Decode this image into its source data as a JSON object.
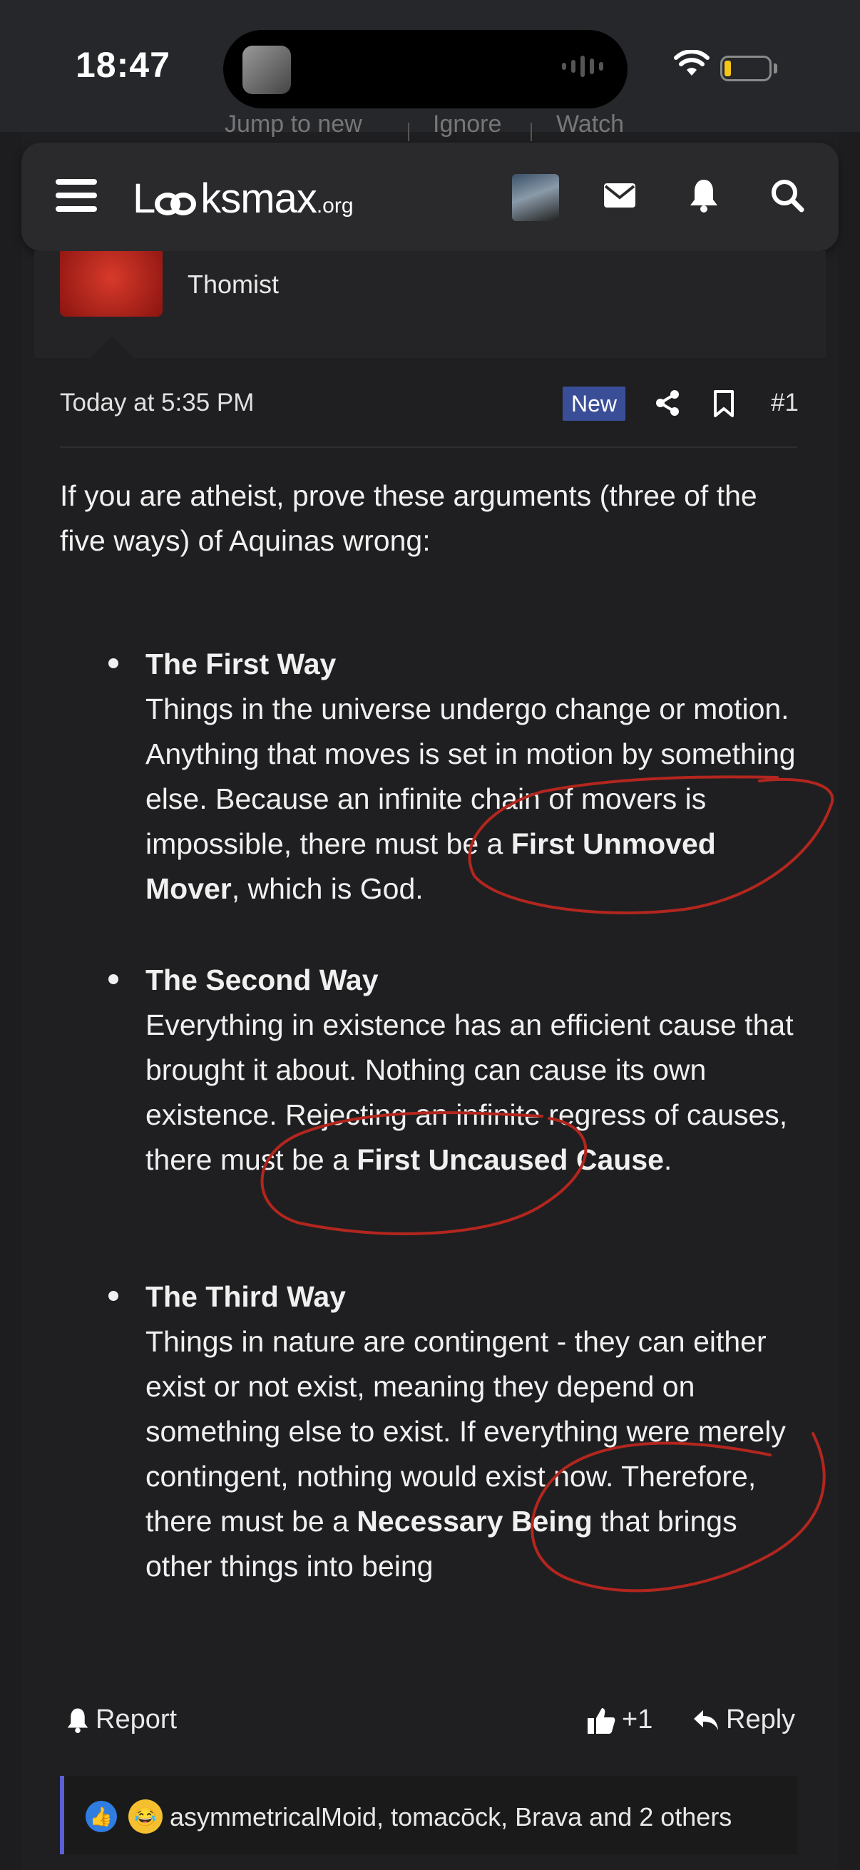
{
  "status_bar": {
    "time": "18:47"
  },
  "forum_top_links": [
    "Jump to new",
    "Ignore",
    "Watch"
  ],
  "header": {
    "logo_main": "Lks max",
    "logo_o": "oo",
    "logo_suffix": ".org"
  },
  "post": {
    "author_title": "Thomist",
    "date": "Today at 5:35 PM",
    "new_badge": "New",
    "post_number": "#1",
    "intro": "If you are atheist, prove these arguments (three of the five ways) of Aquinas wrong:",
    "ways": [
      {
        "title": "The First Way",
        "text_before": "Things in the universe undergo change or motion. Anything that moves is set in motion by something else. Because an infinite chain of movers is impossible, there must be a ",
        "bold": "First Unmoved Mover",
        "text_after": ", which is God."
      },
      {
        "title": "The Second Way",
        "text_before": "Everything in existence has an efficient cause that brought it about. Nothing can cause its own existence. Rejecting an infinite regress of causes, there must be a ",
        "bold": "First Uncaused Cause",
        "text_after": "."
      },
      {
        "title": "The Third Way",
        "text_before": "Things in nature are contingent - they can either exist or not exist, meaning they depend on something else to exist. If everything were merely contingent, nothing would exist now. Therefore, there must be a ",
        "bold": "Necessary Being",
        "text_after": " that brings other things into being"
      }
    ],
    "actions": {
      "report": "Report",
      "like_count": "+1",
      "reply": "Reply"
    },
    "reactions_text": "asymmetricalMoid, tomacōck, Brava and 2 others"
  },
  "colors": {
    "accent_badge": "#3a4e98",
    "annotation": "#b3261e",
    "reaction_border": "#5b5fd6"
  }
}
